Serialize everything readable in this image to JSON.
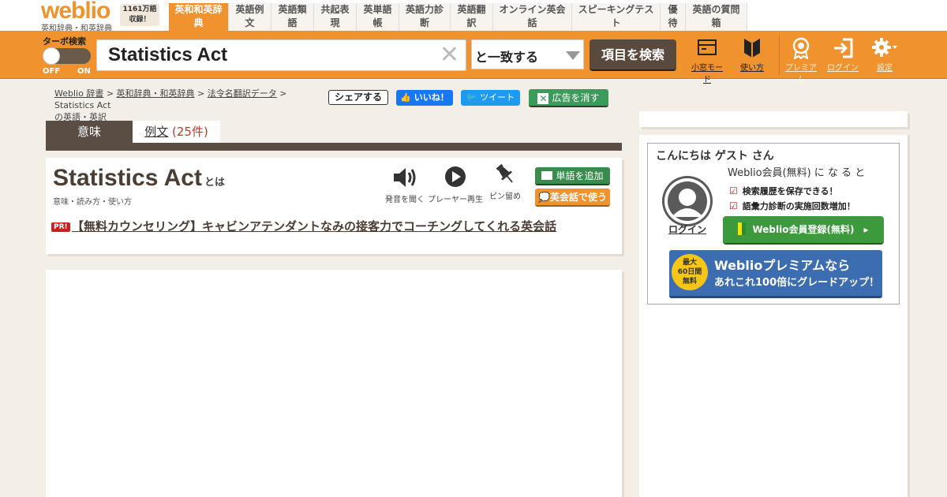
{
  "header": {
    "logo": "weblio",
    "logo_sub": "英和辞典・和英辞典",
    "count_badge_line1": "1161万語",
    "count_badge_line2": "収録！",
    "nav": [
      {
        "label": "英和和英辞典",
        "active": true
      },
      {
        "label": "英語例文",
        "active": false
      },
      {
        "label": "英語類語",
        "active": false
      },
      {
        "label": "共起表現",
        "active": false
      },
      {
        "label": "英単語帳",
        "active": false
      },
      {
        "label": "英語力診断",
        "active": false
      },
      {
        "label": "英語翻訳",
        "active": false
      },
      {
        "label": "オンライン英会話",
        "active": false
      },
      {
        "label": "スピーキングテスト",
        "active": false
      },
      {
        "label": "優待",
        "active": false
      },
      {
        "label": "英語の質問箱",
        "active": false
      }
    ]
  },
  "search": {
    "turbo_label": "ターボ検索",
    "toggle_off": "OFF",
    "toggle_on": "ON",
    "query": "Statistics Act",
    "match_mode": "と一致する",
    "button_label": "項目を検索"
  },
  "tools": {
    "small_window": "小窓モード",
    "how_to_use": "使い方",
    "premium": "プレミアム",
    "login": "ログイン",
    "settings": "設定"
  },
  "breadcrumb": {
    "items": [
      "Weblio 辞書",
      "英和辞典・和英辞典",
      "法令名翻訳データ"
    ],
    "current": "Statistics Act",
    "current_suffix": "の英語・英訳"
  },
  "social": {
    "share": "シェアする",
    "like": "いいね！",
    "tweet": "ツイート",
    "remove_ads": "広告を消す"
  },
  "content_tabs": {
    "meaning": "意味",
    "examples": "例文",
    "examples_count": "(25件)"
  },
  "entry": {
    "word": "Statistics Act",
    "word_suffix": "とは",
    "subtitle": "意味・読み方・使い方",
    "actions": {
      "pronounce": "発音を聞く",
      "player": "プレーヤー再生",
      "pin": "ピン留め"
    },
    "add_word": "単語を追加",
    "eikaiwa": "英会話で使う",
    "pr_badge": "PR!",
    "pr_link": "【無料カウンセリング】キャビンアテンダントなみの接客力でコーチングしてくれる英会話"
  },
  "sidebar": {
    "greeting": "こんにちは ゲスト さん",
    "login": "ログイン",
    "member_head": "Weblio会員(無料) に な る と",
    "benefits": [
      "検索履歴を保存できる！",
      "語彙力診断の実施回数増加！"
    ],
    "register_button": "Weblio会員登録(無料)",
    "premium_badge_line1": "最大",
    "premium_badge_line2": "60日間",
    "premium_badge_line3": "無料",
    "premium_line1": "Weblioプレミアムなら",
    "premium_line2": "あれこれ100倍にグレードアップ！"
  },
  "colors": {
    "brand_orange": "#f0922e",
    "dark_brown": "#5a4d44",
    "green": "#3c9a5a",
    "pr_red": "#cc1f1f"
  }
}
